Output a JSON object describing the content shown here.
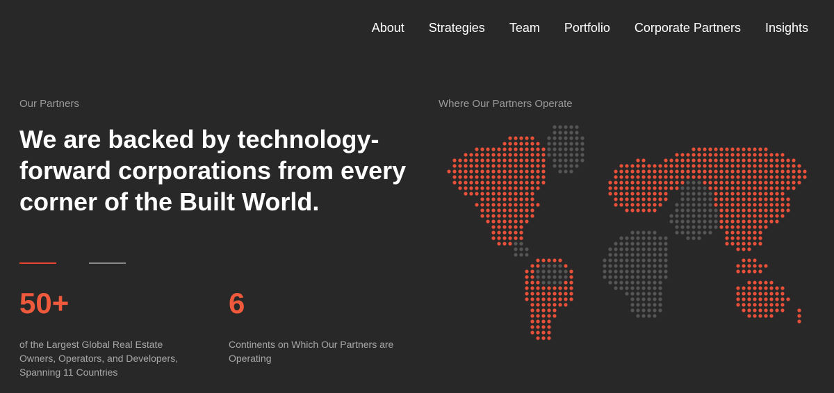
{
  "nav": {
    "items": [
      "About",
      "Strategies",
      "Team",
      "Portfolio",
      "Corporate Partners",
      "Insights"
    ]
  },
  "partners": {
    "eyebrow": "Our Partners",
    "headline": "We are backed by technology-forward corporations from every corner of the Built World."
  },
  "map": {
    "eyebrow": "Where Our Partners Operate"
  },
  "stats": [
    {
      "value": "50+",
      "description": "of the Largest Global Real Estate Owners, Operators, and Developers, Spanning 11 Countries"
    },
    {
      "value": "6",
      "description": "Continents on Which Our Partners are Operating"
    }
  ],
  "colors": {
    "background": "#282828",
    "accent": "#f05a3c",
    "dot_active": "#e8503a",
    "dot_inactive": "#555555"
  }
}
